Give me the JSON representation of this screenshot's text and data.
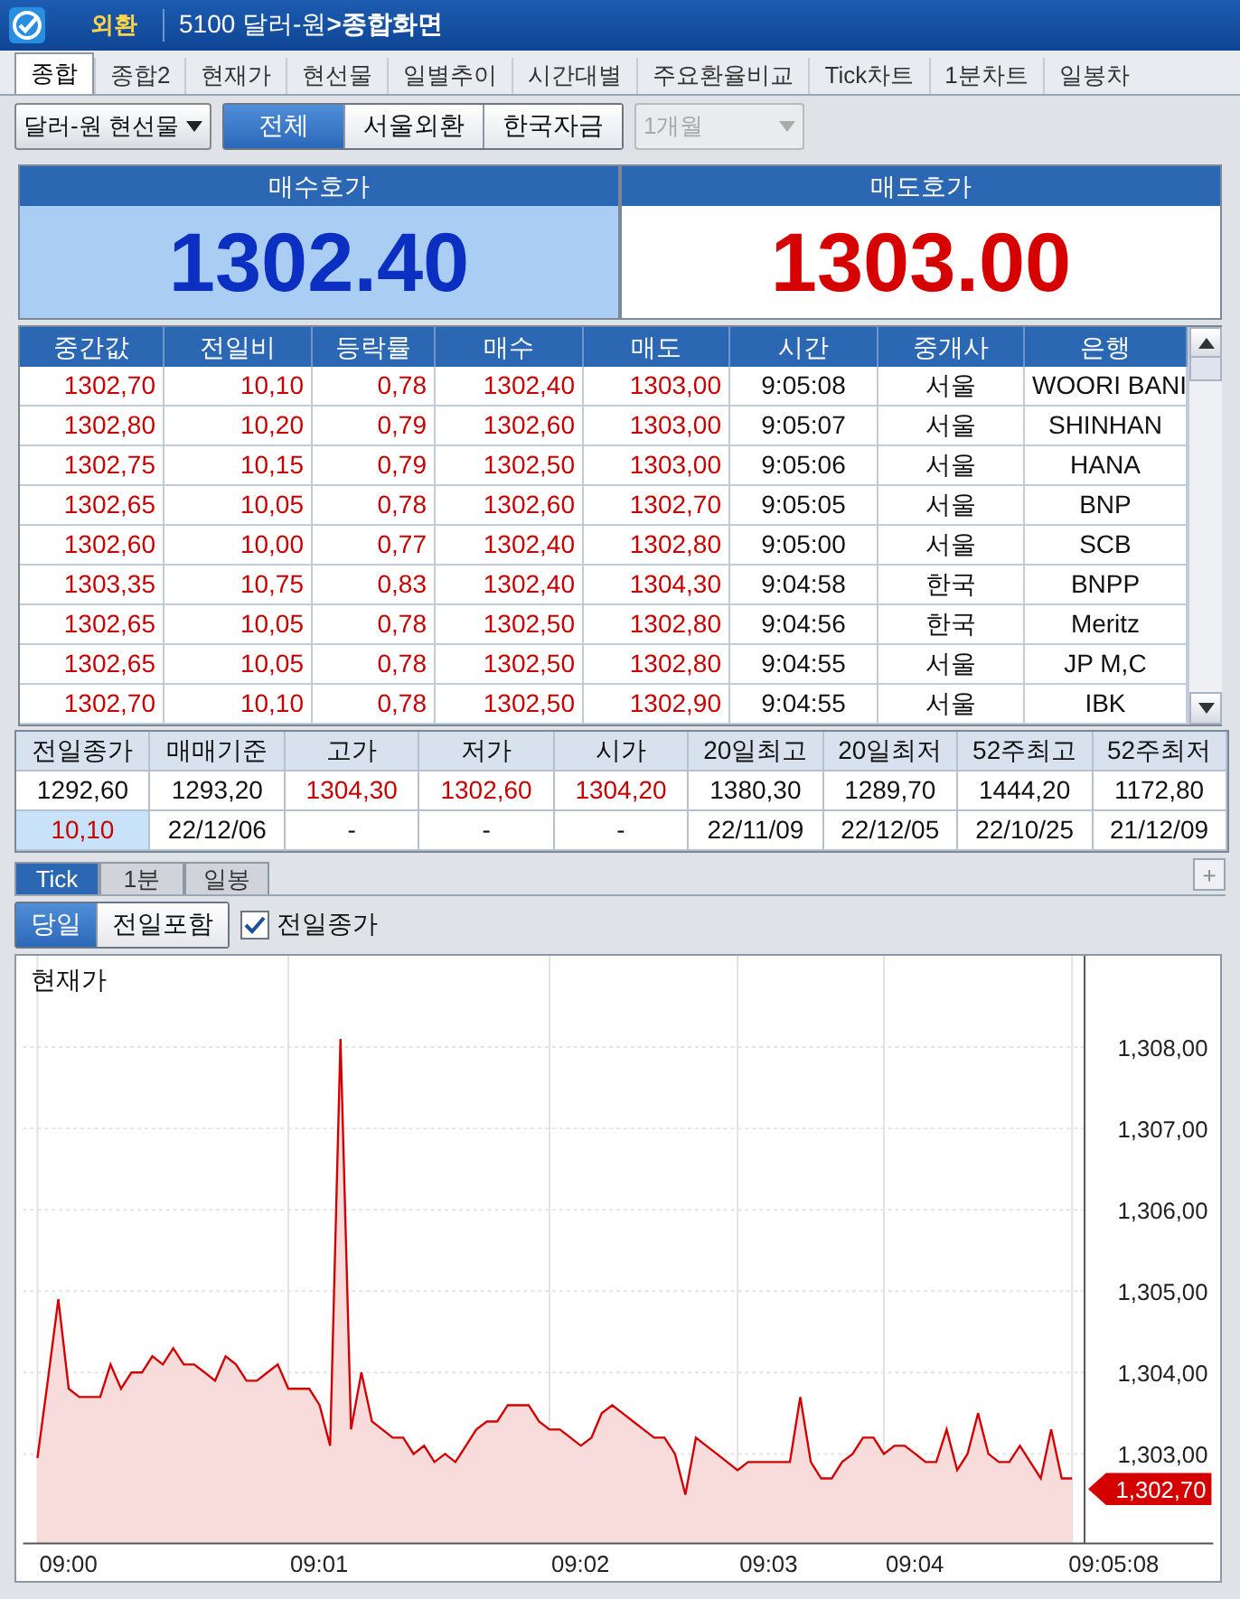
{
  "title_bar": {
    "badge": "외환",
    "breadcrumb": "5100 달러-원**>종합화면**"
  },
  "tabs": [
    {
      "label": "종합",
      "selected": true
    },
    {
      "label": "종합2",
      "selected": false
    },
    {
      "label": "현재가",
      "selected": false
    },
    {
      "label": "현선물",
      "selected": false
    },
    {
      "label": "일별추이",
      "selected": false
    },
    {
      "label": "시간대별",
      "selected": false
    },
    {
      "label": "주요환율비교",
      "selected": false
    },
    {
      "label": "Tick차트",
      "selected": false
    },
    {
      "label": "1분차트",
      "selected": false
    },
    {
      "label": "일봉차",
      "selected": false
    }
  ],
  "toolbar": {
    "instrument": {
      "value": "달러-원 현선물"
    },
    "segments": [
      {
        "label": "전체",
        "selected": true
      },
      {
        "label": "서울외환",
        "selected": false
      },
      {
        "label": "한국자금",
        "selected": false
      }
    ],
    "period": {
      "value": "1개월",
      "disabled": true
    }
  },
  "quotes": {
    "bid": {
      "label": "매수호가",
      "price": "1302.40"
    },
    "ask": {
      "label": "매도호가",
      "price": "1303.00"
    }
  },
  "trades": {
    "columns": [
      {
        "label": "중간값",
        "kind": "price"
      },
      {
        "label": "전일비",
        "kind": "price"
      },
      {
        "label": "등락률",
        "kind": "price"
      },
      {
        "label": "매수",
        "kind": "price"
      },
      {
        "label": "매도",
        "kind": "price"
      },
      {
        "label": "시간",
        "kind": "text"
      },
      {
        "label": "중개사",
        "kind": "text"
      },
      {
        "label": "은행",
        "kind": "text"
      }
    ],
    "rows": [
      [
        "1302,70",
        "10,10",
        "0,78",
        "1302,40",
        "1303,00",
        "9:05:08",
        "서울",
        "WOORI BANI"
      ],
      [
        "1302,80",
        "10,20",
        "0,79",
        "1302,60",
        "1303,00",
        "9:05:07",
        "서울",
        "SHINHAN"
      ],
      [
        "1302,75",
        "10,15",
        "0,79",
        "1302,50",
        "1303,00",
        "9:05:06",
        "서울",
        "HANA"
      ],
      [
        "1302,65",
        "10,05",
        "0,78",
        "1302,60",
        "1302,70",
        "9:05:05",
        "서울",
        "BNP"
      ],
      [
        "1302,60",
        "10,00",
        "0,77",
        "1302,40",
        "1302,80",
        "9:05:00",
        "서울",
        "SCB"
      ],
      [
        "1303,35",
        "10,75",
        "0,83",
        "1302,40",
        "1304,30",
        "9:04:58",
        "한국",
        "BNPP"
      ],
      [
        "1302,65",
        "10,05",
        "0,78",
        "1302,50",
        "1302,80",
        "9:04:56",
        "한국",
        "Meritz"
      ],
      [
        "1302,65",
        "10,05",
        "0,78",
        "1302,50",
        "1302,80",
        "9:04:55",
        "서울",
        "JP M,C"
      ],
      [
        "1302,70",
        "10,10",
        "0,78",
        "1302,50",
        "1302,90",
        "9:04:55",
        "서울",
        "IBK"
      ]
    ]
  },
  "summary": {
    "columns": [
      "전일종가",
      "매매기준",
      "고가",
      "저가",
      "시가",
      "20일최고",
      "20일최저",
      "52주최고",
      "52주최저"
    ],
    "rows": [
      [
        {
          "text": "1292,60",
          "kind": "plain"
        },
        {
          "text": "1293,20",
          "kind": "plain"
        },
        {
          "text": "1304,30",
          "kind": "up"
        },
        {
          "text": "1302,60",
          "kind": "up"
        },
        {
          "text": "1304,20",
          "kind": "up"
        },
        {
          "text": "1380,30",
          "kind": "plain"
        },
        {
          "text": "1289,70",
          "kind": "plain"
        },
        {
          "text": "1444,20",
          "kind": "plain"
        },
        {
          "text": "1172,80",
          "kind": "plain"
        }
      ],
      [
        {
          "text": "10,10",
          "kind": "change"
        },
        {
          "text": "22/12/06",
          "kind": "plain"
        },
        {
          "text": "-",
          "kind": "plain"
        },
        {
          "text": "-",
          "kind": "plain"
        },
        {
          "text": "-",
          "kind": "plain"
        },
        {
          "text": "22/11/09",
          "kind": "plain"
        },
        {
          "text": "22/12/05",
          "kind": "plain"
        },
        {
          "text": "22/10/25",
          "kind": "plain"
        },
        {
          "text": "21/12/09",
          "kind": "plain"
        }
      ]
    ]
  },
  "chart_panel": {
    "tabs": [
      {
        "label": "Tick",
        "selected": true
      },
      {
        "label": "1분",
        "selected": false
      },
      {
        "label": "일봉",
        "selected": false
      }
    ],
    "add_button": "+",
    "range": [
      {
        "label": "당일",
        "selected": true
      },
      {
        "label": "전일포함",
        "selected": false
      }
    ],
    "prev_close": {
      "label": "전일종가",
      "checked": true
    },
    "current_price": "1,302,70",
    "chart": {
      "title": "현재가",
      "y_labels": [
        "1,308,00",
        "1,307,00",
        "1,306,00",
        "1,305,00",
        "1,304,00",
        "1,303,00"
      ],
      "x_labels": [
        "09:00",
        "09:01",
        "09:02",
        "09:03",
        "09:04",
        "09:05:08"
      ]
    }
  }
}
